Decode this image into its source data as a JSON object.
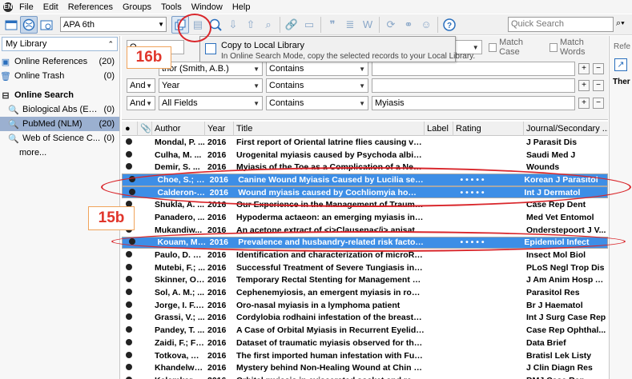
{
  "menu": {
    "app_logo": "EN",
    "items": [
      "File",
      "Edit",
      "References",
      "Groups",
      "Tools",
      "Window",
      "Help"
    ]
  },
  "toolbar": {
    "style_select": "APA 6th",
    "quick_search_placeholder": "Quick Search",
    "right_label": "Refe"
  },
  "sidebar": {
    "my_library": "My Library",
    "items": [
      {
        "label": "Online References",
        "count": "(20)"
      },
      {
        "label": "Online Trash",
        "count": "(0)"
      }
    ],
    "online_search_header": "Online Search",
    "search_items": [
      {
        "label": "Biological Abs (EB...",
        "count": "(0)"
      },
      {
        "label": "PubMed (NLM)",
        "count": "(20)"
      },
      {
        "label": "Web of Science C...",
        "count": "(0)"
      }
    ],
    "more": "more..."
  },
  "search_panel": {
    "rows": [
      {
        "bool": "",
        "field": "thor (Smith, A.B.)",
        "op": "Contains",
        "value": ""
      },
      {
        "bool": "And",
        "field": "Year",
        "op": "Contains",
        "value": ""
      },
      {
        "bool": "And",
        "field": "All Fields",
        "op": "Contains",
        "value": "Myiasis"
      }
    ],
    "match_case": "Match Case",
    "match_words": "Match Words",
    "top_button_partial": "O"
  },
  "right_panel": {
    "label": "Ther"
  },
  "tooltip": {
    "title": "Copy to Local Library",
    "desc": "In Online Search Mode, copy the selected records to your Local Library."
  },
  "annotations": {
    "a16b": "16b",
    "a15b": "15b"
  },
  "table": {
    "headers": [
      "Author",
      "Year",
      "Title",
      "Label",
      "Rating",
      "Journal/Secondary ..."
    ],
    "rows": [
      {
        "author": "Mondal, P. ...",
        "year": "2016",
        "title": "First report of Oriental latrine flies causing vagina...",
        "label": "",
        "rating": "",
        "journal": "J Parasit Dis",
        "selected": false
      },
      {
        "author": "Culha, M. ...",
        "year": "2016",
        "title": "Urogenital myiasis caused by Psychoda albipennis",
        "label": "",
        "rating": "",
        "journal": "Saudi Med J",
        "selected": false
      },
      {
        "author": "Demir, S. ...",
        "year": "2016",
        "title": "Myiasis of the Toe as a Complication of a Neglect...",
        "label": "",
        "rating": "",
        "journal": "Wounds",
        "selected": false
      },
      {
        "author": "Choe, S.; L...",
        "year": "2016",
        "title": "Canine Wound Myiasis Caused by Lucilia sericata (...",
        "label": "",
        "rating": "• • • • •",
        "journal": "Korean J Parasitol",
        "selected": true
      },
      {
        "author": "Calderon-C...",
        "year": "2016",
        "title": "Wound myiasis caused by Cochliomyia hominivora...",
        "label": "",
        "rating": "• • • • •",
        "journal": "Int J Dermatol",
        "selected": true
      },
      {
        "author": "Shukla, A. ...",
        "year": "2016",
        "title": "Our Experience in the Management of Traumatic...",
        "label": "",
        "rating": "",
        "journal": "Case Rep Dent",
        "selected": false
      },
      {
        "author": "Panadero, ...",
        "year": "2016",
        "title": "Hypoderma actaeon: an emerging myiasis in roe d...",
        "label": "",
        "rating": "",
        "journal": "Med Vet Entomol",
        "selected": false
      },
      {
        "author": "Mukandiw...",
        "year": "2016",
        "title": "An acetone extract of <i>Clausena</i> anisat...",
        "label": "",
        "rating": "",
        "journal": "Onderstepoort J V...",
        "selected": false
      },
      {
        "author": "Kouam, M. ...",
        "year": "2016",
        "title": "Prevalence and husbandry-related risk factors of ...",
        "label": "",
        "rating": "• • • • •",
        "journal": "Epidemiol Infect",
        "selected": true
      },
      {
        "author": "Paulo, D. F....",
        "year": "2016",
        "title": "Identification and characterization of microRNAs ...",
        "label": "",
        "rating": "",
        "journal": "Insect Mol Biol",
        "selected": false
      },
      {
        "author": "Mutebi, F.; ...",
        "year": "2016",
        "title": "Successful Treatment of Severe Tungiasis in Pigs ...",
        "label": "",
        "rating": "",
        "journal": "PLoS Negl Trop Dis",
        "selected": false
      },
      {
        "author": "Skinner, O....",
        "year": "2016",
        "title": "Temporary Rectal Stenting for Management of S...",
        "label": "",
        "rating": "",
        "journal": "J Am Anim Hosp A...",
        "selected": false
      },
      {
        "author": "Sol, A. M.; ...",
        "year": "2016",
        "title": "Cephenemyiosis, an emergent myiasis in roe deer...",
        "label": "",
        "rating": "",
        "journal": "Parasitol Res",
        "selected": false
      },
      {
        "author": "Jorge, I. F.;...",
        "year": "2016",
        "title": "Oro-nasal myiasis in a lymphoma patient",
        "label": "",
        "rating": "",
        "journal": "Br J Haematol",
        "selected": false
      },
      {
        "author": "Grassi, V.; ...",
        "year": "2016",
        "title": "Cordylobia rodhaini infestation of the breast: Rep...",
        "label": "",
        "rating": "",
        "journal": "Int J Surg Case Rep",
        "selected": false
      },
      {
        "author": "Pandey, T. ...",
        "year": "2016",
        "title": "A Case of Orbital Myiasis in Recurrent Eyelid Basal...",
        "label": "",
        "rating": "",
        "journal": "Case Rep Ophthal...",
        "selected": false
      },
      {
        "author": "Zaidi, F.; Fa...",
        "year": "2016",
        "title": "Dataset of traumatic myiasis observed for three ...",
        "label": "",
        "rating": "",
        "journal": "Data Brief",
        "selected": false
      },
      {
        "author": "Totkova, A....",
        "year": "2016",
        "title": "The first imported human infestation with Furunc...",
        "label": "",
        "rating": "",
        "journal": "Bratisl Lek Listy",
        "selected": false
      },
      {
        "author": "Khandelwa...",
        "year": "2016",
        "title": "Mystery behind Non-Healing Wound at Chin Regi...",
        "label": "",
        "rating": "",
        "journal": "J Clin Diagn Res",
        "selected": false
      },
      {
        "author": "Kalamkar, ...",
        "year": "2016",
        "title": "Orbital myiasis in eviscerated socket and review ...",
        "label": "",
        "rating": "",
        "journal": "BMJ Case Rep",
        "selected": false
      }
    ]
  }
}
